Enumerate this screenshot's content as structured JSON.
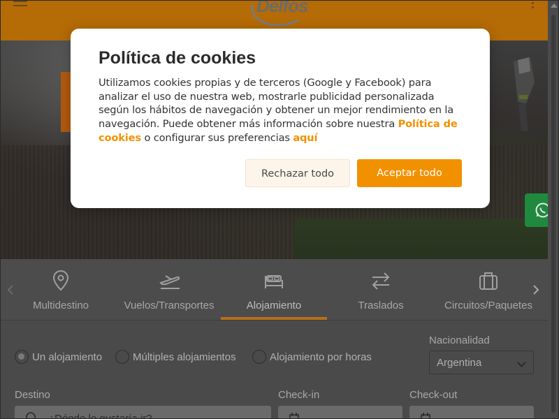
{
  "header": {
    "logo_text": "Delfos",
    "menu_icon": "hamburger-icon",
    "more_icon": "kebab-icon",
    "color": "#b56b06"
  },
  "cookie_modal": {
    "title": "Política de cookies",
    "body_text": "Utilizamos cookies propias y de terceros (Google y Facebook) para analizar el uso de nuestra web, mostrarle publicidad personalizada según los hábitos de navegación y obtener un mejor rendimiento en la navegación. Puede obtener más información sobre nuestra ",
    "policy_link": "Política de cookies",
    "middle_text": " o configurar sus preferencias ",
    "here_link": "aquí",
    "reject_label": "Rechazar todo",
    "accept_label": "Aceptar todo",
    "accent_color": "#f29100"
  },
  "nav": {
    "items": [
      {
        "label": "Multidestino",
        "icon": "map-pin-icon"
      },
      {
        "label": "Vuelos/Transportes",
        "icon": "plane-icon"
      },
      {
        "label": "Alojamiento",
        "icon": "bed-icon"
      },
      {
        "label": "Traslados",
        "icon": "transfer-arrows-icon"
      },
      {
        "label": "Circuitos/Paquetes",
        "icon": "suitcase-icon"
      }
    ],
    "active": "Alojamiento"
  },
  "search": {
    "options": [
      "Un alojamiento",
      "Múltiples alojamientos",
      "Alojamiento por horas"
    ],
    "selected_option": "Un alojamiento",
    "nationality_label": "Nacionalidad",
    "nationality_value": "Argentina",
    "destination_label": "Destino",
    "destination_placeholder": "¿Dónde le gustaría ir?",
    "checkin_label": "Check-in",
    "checkout_label": "Check-out"
  },
  "whatsapp": {
    "icon": "whatsapp-icon",
    "color": "#1f8a3e"
  }
}
